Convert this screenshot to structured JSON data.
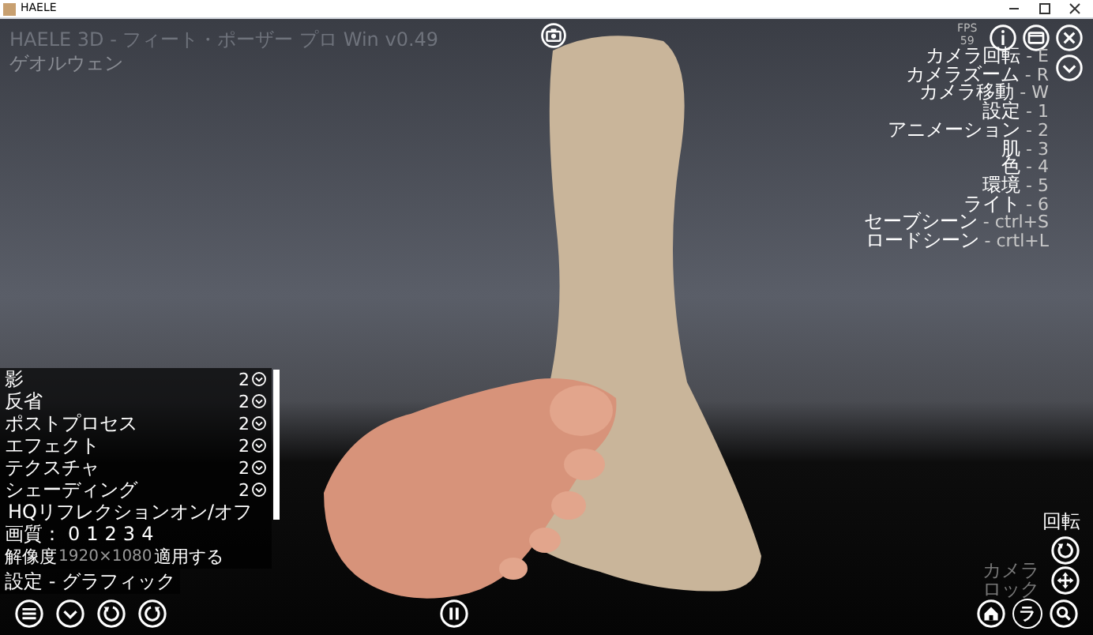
{
  "window": {
    "title": "HAELE"
  },
  "app_title": "HAELE 3D - フィート・ポーザー プロ Win v0.49",
  "subtitle": "ゲオルウェン",
  "fps": {
    "label": "FPS",
    "value": "59"
  },
  "shortcuts": [
    {
      "action": "カメラ回転",
      "key": " - E"
    },
    {
      "action": "カメラズーム",
      "key": " - R"
    },
    {
      "action": "カメラ移動",
      "key": " - W"
    },
    {
      "action": "設定",
      "key": " - 1"
    },
    {
      "action": "アニメーション",
      "key": " - 2"
    },
    {
      "action": "肌",
      "key": " - 3"
    },
    {
      "action": "色",
      "key": " - 4"
    },
    {
      "action": "環境",
      "key": " - 5"
    },
    {
      "action": "ライト",
      "key": " - 6"
    },
    {
      "action": "セーブシーン",
      "key": " - ctrl+S"
    },
    {
      "action": "ロードシーン",
      "key": " - crtl+L"
    }
  ],
  "settings": {
    "title": "設定 - グラフィック",
    "rows": [
      {
        "kind": "dropdown",
        "label": "影",
        "value": "2"
      },
      {
        "kind": "dropdown",
        "label": "反省",
        "value": "2"
      },
      {
        "kind": "dropdown",
        "label": "ポストプロセス",
        "value": "2"
      },
      {
        "kind": "dropdown",
        "label": "エフェクト",
        "value": "2"
      },
      {
        "kind": "dropdown",
        "label": "テクスチャ",
        "value": "2"
      },
      {
        "kind": "dropdown",
        "label": "シェーディング",
        "value": "2"
      },
      {
        "kind": "toggle",
        "label": "HQリフレクションオン/オフ"
      },
      {
        "kind": "choice",
        "label": "画質：",
        "options": [
          "0",
          "1",
          "2",
          "3",
          "4"
        ]
      },
      {
        "kind": "apply",
        "label": "解像度",
        "value": "1920×1080",
        "action": "適用する"
      }
    ]
  },
  "rotate_label": "回転",
  "camera_lock": "カメラロック",
  "letter_button": "ラ"
}
